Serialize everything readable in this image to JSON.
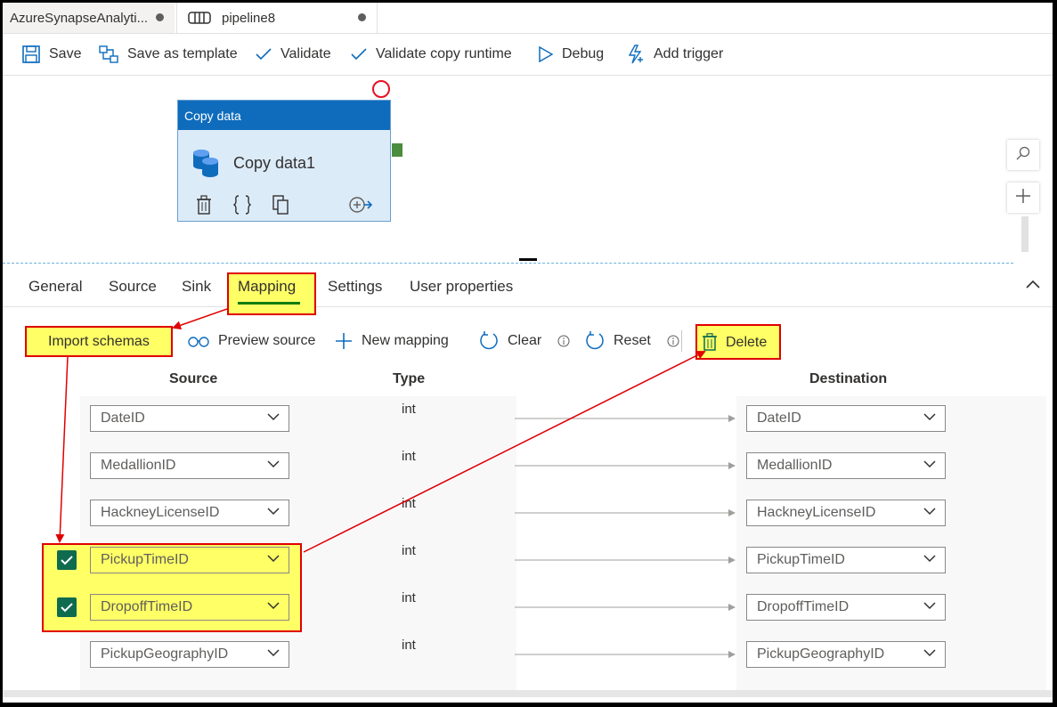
{
  "tabs": [
    {
      "label": "AzureSynapseAnalyti..."
    },
    {
      "label": "pipeline8"
    }
  ],
  "toolbar": {
    "save": "Save",
    "save_template": "Save as template",
    "validate": "Validate",
    "validate_runtime": "Validate copy runtime",
    "debug": "Debug",
    "add_trigger": "Add trigger"
  },
  "activity": {
    "header": "Copy data",
    "name": "Copy data1"
  },
  "panel_tabs": [
    "General",
    "Source",
    "Sink",
    "Mapping",
    "Settings",
    "User properties"
  ],
  "actions": {
    "import_schemas": "Import schemas",
    "preview_source": "Preview source",
    "new_mapping": "New mapping",
    "clear": "Clear",
    "reset": "Reset",
    "delete": "Delete"
  },
  "columns": {
    "source": "Source",
    "type": "Type",
    "destination": "Destination"
  },
  "mappings": [
    {
      "source": "DateID",
      "type": "int",
      "destination": "DateID",
      "checked": false
    },
    {
      "source": "MedallionID",
      "type": "int",
      "destination": "MedallionID",
      "checked": false
    },
    {
      "source": "HackneyLicenseID",
      "type": "int",
      "destination": "HackneyLicenseID",
      "checked": false
    },
    {
      "source": "PickupTimeID",
      "type": "int",
      "destination": "PickupTimeID",
      "checked": true
    },
    {
      "source": "DropoffTimeID",
      "type": "int",
      "destination": "DropoffTimeID",
      "checked": true
    },
    {
      "source": "PickupGeographyID",
      "type": "int",
      "destination": "PickupGeographyID",
      "checked": false
    }
  ],
  "colors": {
    "accent": "#0f6cbd",
    "highlight": "#ffff66",
    "annotation": "#e00000",
    "checkbox": "#0f6b4f"
  }
}
